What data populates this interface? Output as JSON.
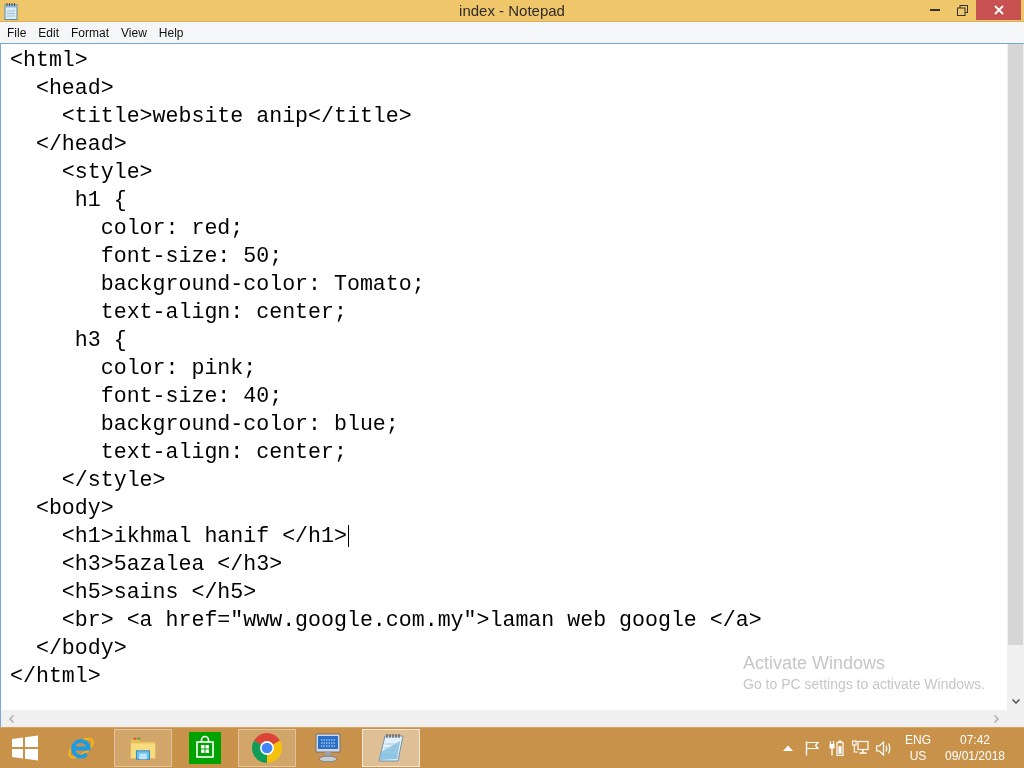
{
  "window": {
    "title": "index - Notepad"
  },
  "menu": [
    "File",
    "Edit",
    "Format",
    "View",
    "Help"
  ],
  "editor": {
    "lines": [
      {
        "text": "<html>",
        "caret": false
      },
      {
        "text": "  <head>",
        "caret": false
      },
      {
        "text": "    <title>website anip</title>",
        "caret": false
      },
      {
        "text": "  </head>",
        "caret": false
      },
      {
        "text": "    <style>",
        "caret": false
      },
      {
        "text": "     h1 {",
        "caret": false
      },
      {
        "text": "       color: red;",
        "caret": false
      },
      {
        "text": "       font-size: 50;",
        "caret": false
      },
      {
        "text": "       background-color: Tomato;",
        "caret": false
      },
      {
        "text": "       text-align: center;",
        "caret": false
      },
      {
        "text": "     h3 {",
        "caret": false
      },
      {
        "text": "       color: pink;",
        "caret": false
      },
      {
        "text": "       font-size: 40;",
        "caret": false
      },
      {
        "text": "       background-color: blue;",
        "caret": false
      },
      {
        "text": "       text-align: center;",
        "caret": false
      },
      {
        "text": "    </style>",
        "caret": false
      },
      {
        "text": "  <body>",
        "caret": false
      },
      {
        "text": "    <h1>ikhmal hanif </h1>",
        "caret": true
      },
      {
        "text": "    <h3>5azalea </h3>",
        "caret": false
      },
      {
        "text": "    <h5>sains </h5>",
        "caret": false
      },
      {
        "text": "    <br> <a href=\"www.google.com.my\">laman web google </a>",
        "caret": false
      },
      {
        "text": "  </body>",
        "caret": false
      },
      {
        "text": "</html>",
        "caret": false
      }
    ]
  },
  "activation_notice": {
    "title": "Activate Windows",
    "text": "Go to PC settings to activate Windows."
  },
  "taskbar": {
    "apps": [
      {
        "kind": "ering",
        "running": false,
        "selected": false
      },
      {
        "kind": "folder",
        "running": true,
        "selected": false
      },
      {
        "kind": "bag",
        "running": false,
        "selected": false
      },
      {
        "kind": "wheel",
        "running": true,
        "selected": false
      },
      {
        "kind": "monitor",
        "running": false,
        "selected": false
      },
      {
        "kind": "notepad",
        "running": true,
        "selected": true
      }
    ],
    "tray": {
      "language": "ENG",
      "region": "US",
      "time": "07:42",
      "date": "09/01/2018"
    }
  }
}
